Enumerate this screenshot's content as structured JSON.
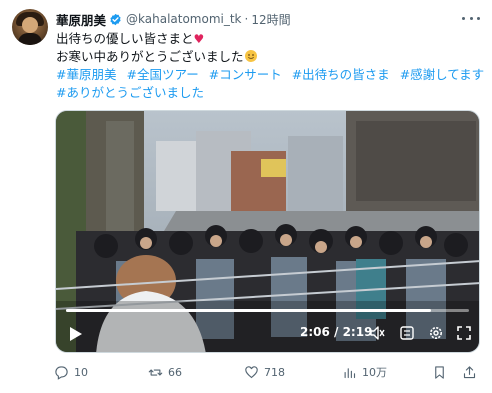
{
  "author": {
    "display_name": "華原朋美",
    "handle": "@kahalatomomi_tk",
    "separator": "·",
    "time": "12時間",
    "verified": true
  },
  "tweet": {
    "line1": "出待ちの優しい皆さまと",
    "line2": "お寒い中ありがとうございました",
    "hashtags_row1": [
      "#華原朋美",
      "#全国ツアー",
      "#コンサート",
      "#出待ちの皆さま",
      "#感謝してます"
    ],
    "hashtags_row2": [
      "#ありがとうございました"
    ]
  },
  "video": {
    "current_time": "2:06",
    "duration": "2:19",
    "timecode": "2:06 / 2:19",
    "progress": 0.906
  },
  "actions": {
    "replies": "10",
    "retweets": "66",
    "likes": "718",
    "views": "10万"
  },
  "colors": {
    "link": "#1d9bf0",
    "muted": "#536471",
    "heart": "#e0245e",
    "verified": "#1d9bf0"
  },
  "icons": [
    "verified-badge-icon",
    "more-icon",
    "heart-emoji",
    "smile-emoji",
    "play-icon",
    "volume-icon",
    "captions-icon",
    "settings-icon",
    "fullscreen-icon",
    "reply-icon",
    "retweet-icon",
    "like-icon",
    "views-icon",
    "bookmark-icon",
    "share-icon"
  ]
}
